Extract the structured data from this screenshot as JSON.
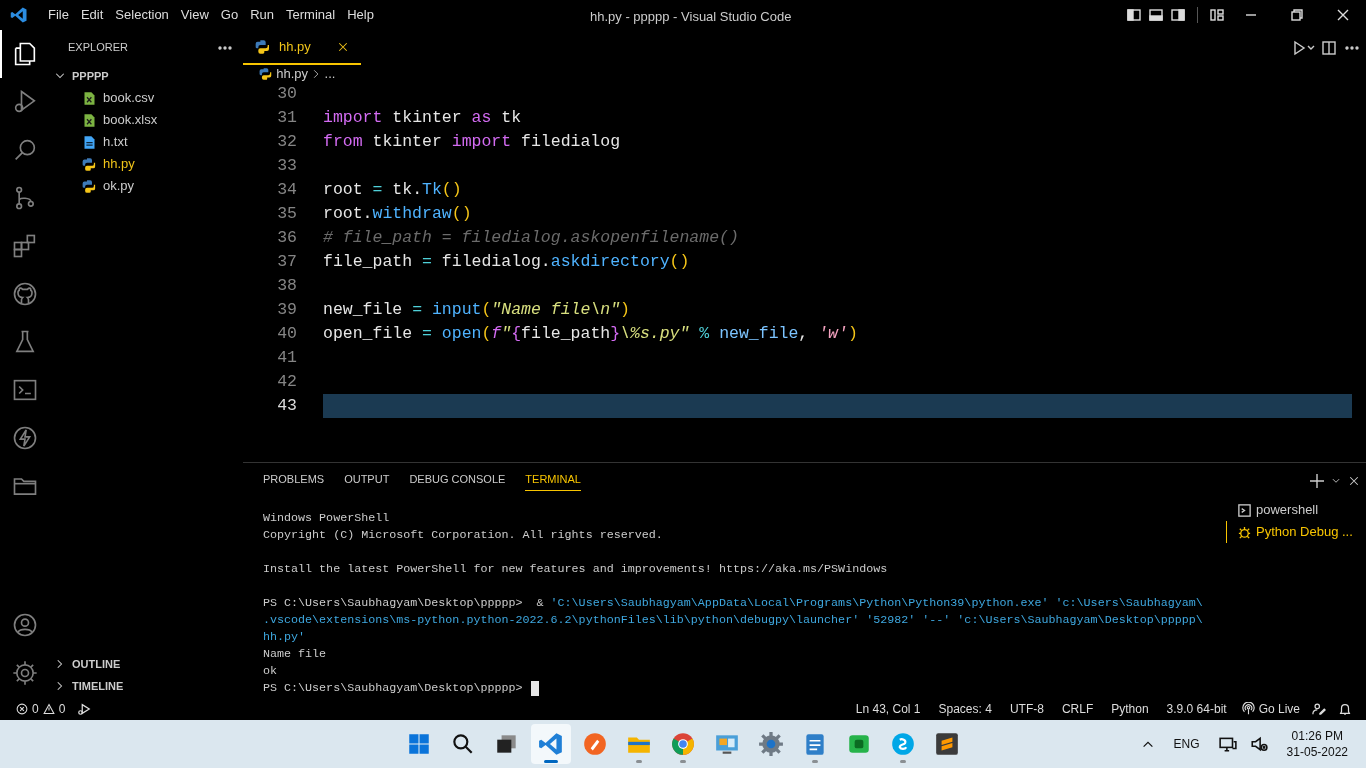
{
  "window": {
    "title": "hh.py - ppppp - Visual Studio Code"
  },
  "menu": [
    "File",
    "Edit",
    "Selection",
    "View",
    "Go",
    "Run",
    "Terminal",
    "Help"
  ],
  "activity_bar": [
    {
      "kind": "explorer",
      "selected": true
    },
    {
      "kind": "debug",
      "selected": false
    },
    {
      "kind": "search",
      "selected": false
    },
    {
      "kind": "branch",
      "selected": false
    },
    {
      "kind": "extensions",
      "selected": false
    },
    {
      "kind": "remote",
      "selected": false
    },
    {
      "kind": "flask",
      "selected": false
    },
    {
      "kind": "terminal",
      "selected": false
    },
    {
      "kind": "bolt",
      "selected": false
    },
    {
      "kind": "folder",
      "selected": false
    }
  ],
  "activity_bar_bottom": [
    {
      "kind": "account"
    },
    {
      "kind": "gear"
    }
  ],
  "sidebar": {
    "title": "EXPLORER",
    "folder": {
      "name": "PPPPP",
      "expanded": true,
      "files": [
        {
          "name": "book.csv",
          "kind": "sheet",
          "modified": false
        },
        {
          "name": "book.xlsx",
          "kind": "sheet",
          "modified": false
        },
        {
          "name": "h.txt",
          "kind": "text",
          "modified": false
        },
        {
          "name": "hh.py",
          "kind": "python",
          "modified": true
        },
        {
          "name": "ok.py",
          "kind": "python",
          "modified": false
        }
      ]
    },
    "sections": [
      {
        "name": "OUTLINE",
        "expanded": false
      },
      {
        "name": "TIMELINE",
        "expanded": false
      }
    ]
  },
  "editor": {
    "tabs": [
      {
        "label": "hh.py",
        "kind": "python",
        "selected": true,
        "modified": true
      }
    ],
    "breadcrumb": [
      "hh.py",
      "..."
    ],
    "code": [
      {
        "number": "30",
        "current": false
      },
      {
        "number": "31",
        "current": false,
        "tokens": [
          {
            "t": "import",
            "kind": "keyword"
          },
          {
            "t": " tkinter ",
            "kind": "plain"
          },
          {
            "t": "as",
            "kind": "keyword"
          },
          {
            "t": " tk",
            "kind": "plain"
          }
        ]
      },
      {
        "number": "32",
        "current": false,
        "tokens": [
          {
            "t": "from",
            "kind": "keyword"
          },
          {
            "t": " tkinter ",
            "kind": "plain"
          },
          {
            "t": "import",
            "kind": "keyword"
          },
          {
            "t": " filedialog",
            "kind": "plain"
          }
        ]
      },
      {
        "number": "33",
        "current": false
      },
      {
        "number": "34",
        "current": false,
        "tokens": [
          {
            "t": "root ",
            "kind": "plain"
          },
          {
            "t": "=",
            "kind": "operator"
          },
          {
            "t": " tk.",
            "kind": "plain"
          },
          {
            "t": "Tk",
            "kind": "function"
          },
          {
            "t": "()",
            "kind": "paren"
          }
        ]
      },
      {
        "number": "35",
        "current": false,
        "tokens": [
          {
            "t": "root.",
            "kind": "plain"
          },
          {
            "t": "withdraw",
            "kind": "function"
          },
          {
            "t": "()",
            "kind": "paren"
          }
        ]
      },
      {
        "number": "36",
        "current": false,
        "tokens": [
          {
            "t": "# file_path = filedialog.askopenfilename()",
            "kind": "comment"
          }
        ]
      },
      {
        "number": "37",
        "current": false,
        "tokens": [
          {
            "t": "file_path ",
            "kind": "plain"
          },
          {
            "t": "=",
            "kind": "operator"
          },
          {
            "t": " filedialog.",
            "kind": "plain"
          },
          {
            "t": "askdirectory",
            "kind": "function"
          },
          {
            "t": "()",
            "kind": "paren"
          }
        ]
      },
      {
        "number": "38",
        "current": false
      },
      {
        "number": "39",
        "current": false,
        "tokens": [
          {
            "t": "new_file ",
            "kind": "plain"
          },
          {
            "t": "= ",
            "kind": "operator"
          },
          {
            "t": "input",
            "kind": "function"
          },
          {
            "t": "(",
            "kind": "paren"
          },
          {
            "t": "\"Name file\\n\"",
            "kind": "string"
          },
          {
            "t": ")",
            "kind": "paren"
          }
        ]
      },
      {
        "number": "40",
        "current": false,
        "tokens": [
          {
            "t": "open_file ",
            "kind": "plain"
          },
          {
            "t": "= ",
            "kind": "operator"
          },
          {
            "t": "open",
            "kind": "function"
          },
          {
            "t": "(",
            "kind": "paren"
          },
          {
            "t": "f",
            "kind": "prefix"
          },
          {
            "t": "\"",
            "kind": "string"
          },
          {
            "t": "{",
            "kind": "brace"
          },
          {
            "t": "file_path",
            "kind": "plain"
          },
          {
            "t": "}",
            "kind": "brace"
          },
          {
            "t": "\\%s.py\" ",
            "kind": "string"
          },
          {
            "t": "% ",
            "kind": "operator"
          },
          {
            "t": "new_file",
            "kind": "variable"
          },
          {
            "t": ", ",
            "kind": "plain"
          },
          {
            "t": "'w'",
            "kind": "char"
          },
          {
            "t": ")",
            "kind": "paren"
          }
        ]
      },
      {
        "number": "41",
        "current": false
      },
      {
        "number": "42",
        "current": false
      },
      {
        "number": "43",
        "current": true
      }
    ]
  },
  "panel": {
    "tabs": [
      {
        "label": "PROBLEMS",
        "selected": false
      },
      {
        "label": "OUTPUT",
        "selected": false
      },
      {
        "label": "DEBUG CONSOLE",
        "selected": false
      },
      {
        "label": "TERMINAL",
        "selected": true
      }
    ],
    "terminal_blocks": [
      [
        {
          "parts": [
            {
              "t": "Windows PowerShell",
              "kind": "plain"
            }
          ]
        },
        {
          "parts": [
            {
              "t": "Copyright (C) Microsoft Corporation. All rights reserved.",
              "kind": "plain"
            }
          ]
        }
      ],
      [
        {
          "parts": [
            {
              "t": "Install the latest PowerShell for new features and improvements! https://aka.ms/PSWindows",
              "kind": "plain"
            }
          ]
        }
      ],
      [
        {
          "parts": [
            {
              "t": "PS C:\\Users\\Saubhagyam\\Desktop\\ppppp>  & ",
              "kind": "plain"
            },
            {
              "t": "'C:\\Users\\Saubhagyam\\AppData\\Local\\Programs\\Python\\Python39\\python.exe' 'c:\\Users\\Saubhagyam\\",
              "kind": "string"
            }
          ]
        },
        {
          "parts": [
            {
              "t": ".vscode\\extensions\\ms-python.python-2022.6.2\\pythonFiles\\lib\\python\\debugpy\\launcher' '52982' '--' 'c:\\Users\\Saubhagyam\\Desktop\\ppppp\\",
              "kind": "string"
            }
          ]
        },
        {
          "parts": [
            {
              "t": "hh.py'",
              "kind": "string"
            }
          ]
        },
        {
          "parts": [
            {
              "t": "Name file",
              "kind": "plain"
            }
          ]
        },
        {
          "parts": [
            {
              "t": "ok",
              "kind": "plain"
            }
          ]
        },
        {
          "cursor": true,
          "parts": [
            {
              "t": "PS C:\\Users\\Saubhagyam\\Desktop\\ppppp>",
              "kind": "plain"
            }
          ]
        }
      ]
    ],
    "terminals": [
      {
        "label": "powershell",
        "kind": "shell",
        "selected": false
      },
      {
        "label": "Python Debug ...",
        "kind": "debug",
        "selected": true
      }
    ]
  },
  "status_bar": {
    "errors": "0",
    "warnings": "0",
    "items": [
      "Ln 43, Col 1",
      "Spaces: 4",
      "UTF-8",
      "CRLF",
      "Python",
      "3.9.0 64-bit"
    ],
    "go_live": "Go Live"
  },
  "taskbar": {
    "apps": [
      {
        "kind": "start",
        "selected": false,
        "running": false
      },
      {
        "kind": "search",
        "selected": false,
        "running": false
      },
      {
        "kind": "taskview",
        "selected": false,
        "running": false
      },
      {
        "kind": "vscode",
        "selected": true,
        "running": true
      },
      {
        "kind": "pen",
        "selected": false,
        "running": false
      },
      {
        "kind": "files",
        "selected": false,
        "running": true
      },
      {
        "kind": "chrome",
        "selected": false,
        "running": true
      },
      {
        "kind": "remote",
        "selected": false,
        "running": false
      },
      {
        "kind": "gear",
        "selected": false,
        "running": false
      },
      {
        "kind": "notepad",
        "selected": false,
        "running": true
      },
      {
        "kind": "greenapp",
        "selected": false,
        "running": false
      },
      {
        "kind": "chat",
        "selected": false,
        "running": true
      },
      {
        "kind": "sublime",
        "selected": false,
        "running": false
      }
    ],
    "language": "ENG",
    "time": "01:26 PM",
    "date": "31-05-2022"
  }
}
